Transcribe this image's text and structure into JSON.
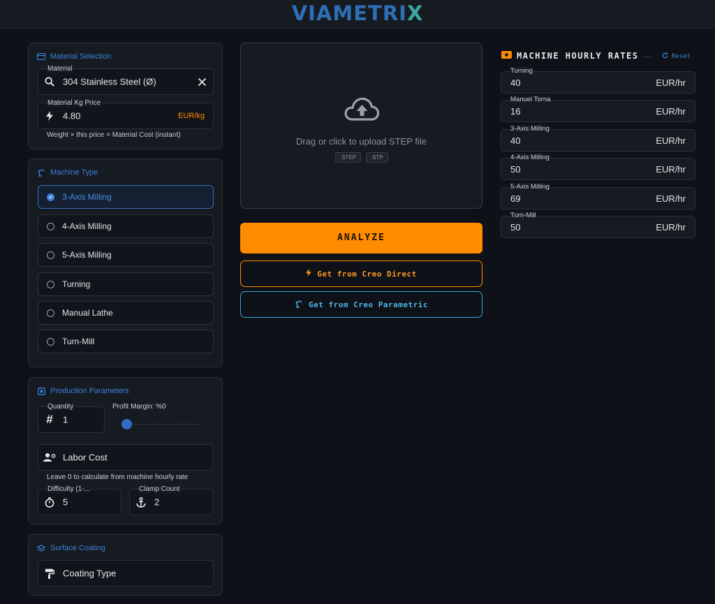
{
  "app": {
    "logo_part1": "VIAMETRI",
    "logo_part2": "X"
  },
  "material": {
    "title": "Material Selection",
    "material_label": "Material",
    "material_value": "304 Stainless Steel (Ø)",
    "price_label": "Material Kg Price",
    "price_value": "4.80",
    "price_unit": "EUR/kg",
    "hint": "Weight × this price = Material Cost (instant)"
  },
  "machine": {
    "title": "Machine Type",
    "options": [
      {
        "label": "3-Axis Milling",
        "selected": true
      },
      {
        "label": "4-Axis Milling",
        "selected": false
      },
      {
        "label": "5-Axis Milling",
        "selected": false
      },
      {
        "label": "Turning",
        "selected": false
      },
      {
        "label": "Manual Lathe",
        "selected": false
      },
      {
        "label": "Turn-Mill",
        "selected": false
      }
    ]
  },
  "production": {
    "title": "Production Parameters",
    "quantity_label": "Quantity",
    "quantity_value": "1",
    "profit_label": "Profit Margin: %0",
    "profit_value": 0,
    "labor_label": "Labor Cost",
    "labor_hint": "Leave 0 to calculate from machine hourly rate",
    "difficulty_label": "Difficulty (1-...",
    "difficulty_value": "5",
    "clamp_label": "Clamp Count",
    "clamp_value": "2"
  },
  "coating": {
    "title": "Surface Coating",
    "placeholder": "Coating Type"
  },
  "upload": {
    "text": "Drag or click to upload STEP file",
    "ext1": ".STEP",
    "ext2": ".STP"
  },
  "actions": {
    "analyze": "ANALYZE",
    "creo_direct": "Get from Creo Direct",
    "creo_parametric": "Get from Creo Parametric"
  },
  "rates": {
    "title": "MACHINE HOURLY RATES",
    "reset": "Reset",
    "items": [
      {
        "label": "Turning",
        "value": "40",
        "unit": "EUR/hr"
      },
      {
        "label": "Manuel Torna",
        "value": "16",
        "unit": "EUR/hr"
      },
      {
        "label": "3-Axis Milling",
        "value": "40",
        "unit": "EUR/hr"
      },
      {
        "label": "4-Axis Milling",
        "value": "50",
        "unit": "EUR/hr"
      },
      {
        "label": "5-Axis Milling",
        "value": "69",
        "unit": "EUR/hr"
      },
      {
        "label": "Turn-Mill",
        "value": "50",
        "unit": "EUR/hr"
      }
    ]
  },
  "colors": {
    "accent": "#3b82d9",
    "orange": "#ff8c00",
    "cyan": "#3ea6d8",
    "background": "#0e1117",
    "panel": "#161a21"
  }
}
